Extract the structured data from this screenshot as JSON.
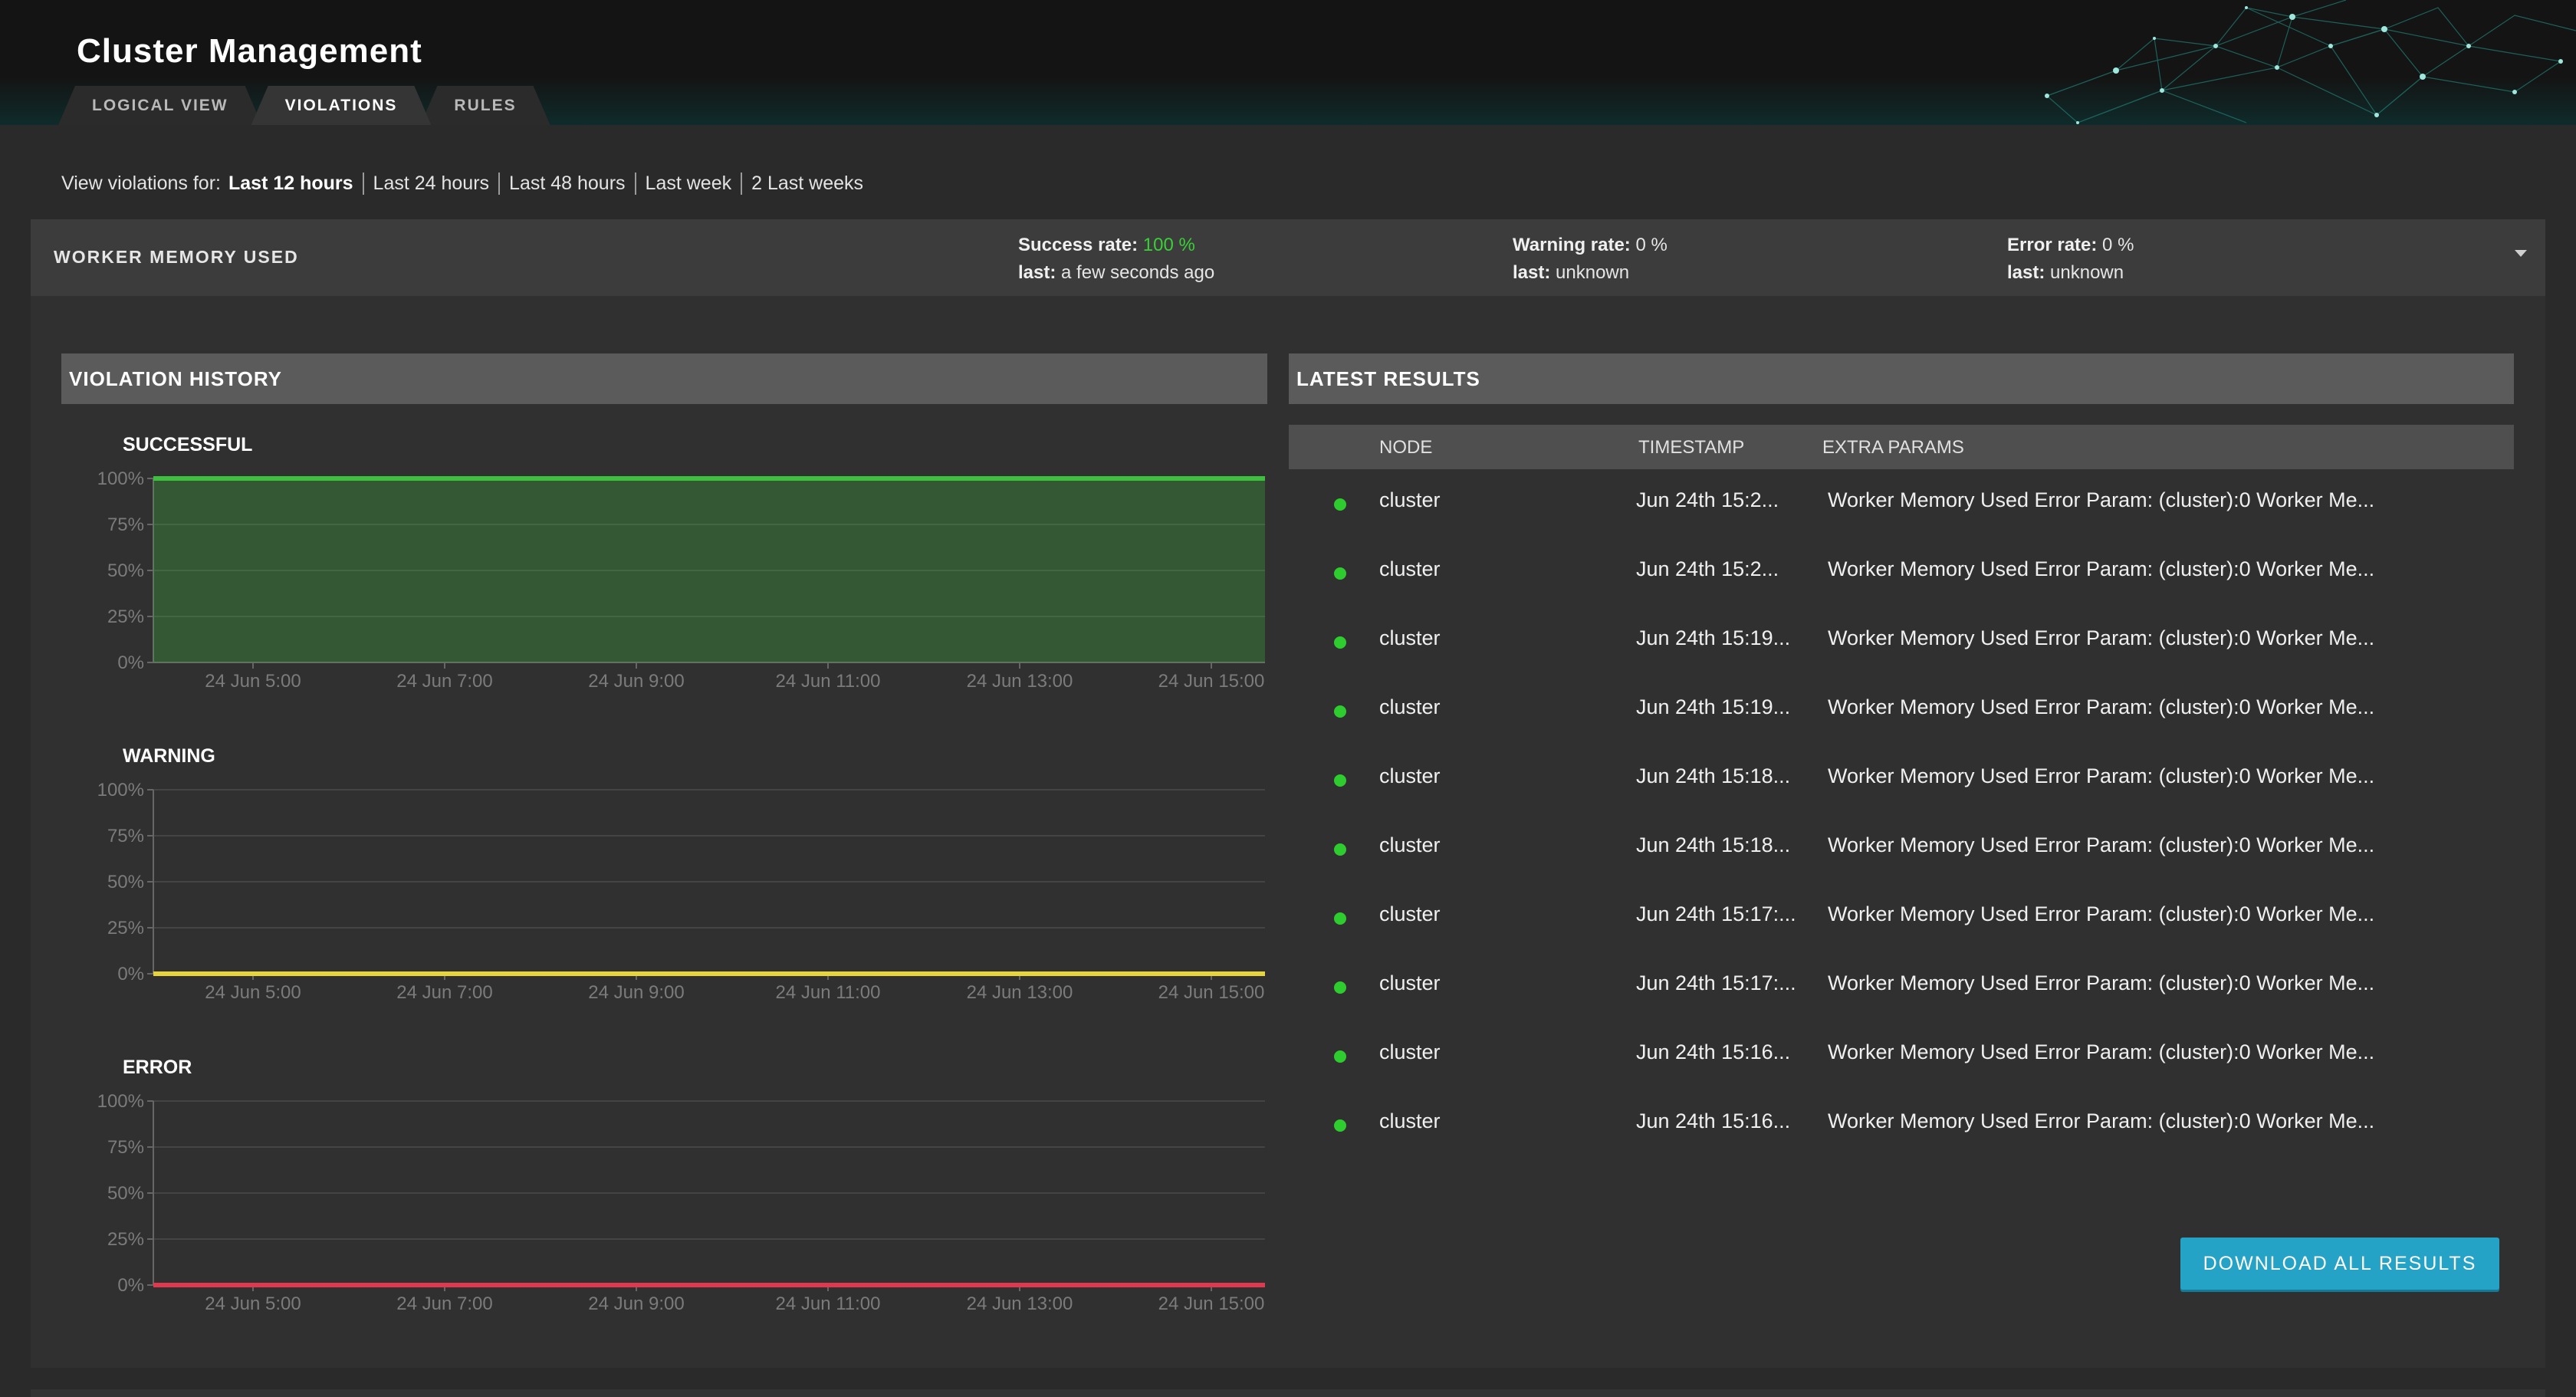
{
  "header": {
    "title": "Cluster Management",
    "tabs": [
      {
        "label": "LOGICAL VIEW",
        "active": false
      },
      {
        "label": "VIOLATIONS",
        "active": true
      },
      {
        "label": "RULES",
        "active": false
      }
    ]
  },
  "range": {
    "label": "View violations for:",
    "options": [
      {
        "label": "Last 12 hours",
        "active": true
      },
      {
        "label": "Last 24 hours",
        "active": false
      },
      {
        "label": "Last 48 hours",
        "active": false
      },
      {
        "label": "Last week",
        "active": false
      },
      {
        "label": "2 Last weeks",
        "active": false
      }
    ]
  },
  "rule": {
    "name": "WORKER MEMORY USED",
    "success": {
      "label": "Success rate:",
      "value": "100 %",
      "last_label": "last:",
      "last": "a few seconds ago"
    },
    "warning": {
      "label": "Warning rate:",
      "value": "0 %",
      "last_label": "last:",
      "last": "unknown"
    },
    "error": {
      "label": "Error rate:",
      "value": "0 %",
      "last_label": "last:",
      "last": "unknown"
    },
    "expand_icon": "chevron-down-icon"
  },
  "history": {
    "title": "VIOLATION HISTORY",
    "charts": [
      "SUCCESSFUL",
      "WARNING",
      "ERROR"
    ]
  },
  "chart_data": [
    {
      "type": "area",
      "title": "SUCCESSFUL",
      "x": [
        "24 Jun 5:00",
        "24 Jun 7:00",
        "24 Jun 9:00",
        "24 Jun 11:00",
        "24 Jun 13:00",
        "24 Jun 15:00"
      ],
      "y_ticks": [
        "100%",
        "75%",
        "50%",
        "25%",
        "0%"
      ],
      "ylim": [
        0,
        100
      ],
      "series": [
        {
          "values": [
            100,
            100,
            100,
            100,
            100,
            100
          ],
          "color": "#3fbf3f"
        }
      ],
      "grid": true
    },
    {
      "type": "line",
      "title": "WARNING",
      "x": [
        "24 Jun 5:00",
        "24 Jun 7:00",
        "24 Jun 9:00",
        "24 Jun 11:00",
        "24 Jun 13:00",
        "24 Jun 15:00"
      ],
      "y_ticks": [
        "100%",
        "75%",
        "50%",
        "25%",
        "0%"
      ],
      "ylim": [
        0,
        100
      ],
      "series": [
        {
          "values": [
            0,
            0,
            0,
            0,
            0,
            0
          ],
          "color": "#e5d43a"
        }
      ],
      "grid": true
    },
    {
      "type": "line",
      "title": "ERROR",
      "x": [
        "24 Jun 5:00",
        "24 Jun 7:00",
        "24 Jun 9:00",
        "24 Jun 11:00",
        "24 Jun 13:00",
        "24 Jun 15:00"
      ],
      "y_ticks": [
        "100%",
        "75%",
        "50%",
        "25%",
        "0%"
      ],
      "ylim": [
        0,
        100
      ],
      "series": [
        {
          "values": [
            0,
            0,
            0,
            0,
            0,
            0
          ],
          "color": "#e0394f"
        }
      ],
      "grid": true
    }
  ],
  "results": {
    "title": "LATEST RESULTS",
    "columns": {
      "node": "NODE",
      "timestamp": "TIMESTAMP",
      "params": "EXTRA PARAMS"
    },
    "rows": [
      {
        "node": "cluster",
        "timestamp": "Jun 24th 15:2...",
        "params": "Worker Memory Used Error Param: (cluster):0 Worker Me..."
      },
      {
        "node": "cluster",
        "timestamp": "Jun 24th 15:2...",
        "params": "Worker Memory Used Error Param: (cluster):0 Worker Me..."
      },
      {
        "node": "cluster",
        "timestamp": "Jun 24th 15:19...",
        "params": "Worker Memory Used Error Param: (cluster):0 Worker Me..."
      },
      {
        "node": "cluster",
        "timestamp": "Jun 24th 15:19...",
        "params": "Worker Memory Used Error Param: (cluster):0 Worker Me..."
      },
      {
        "node": "cluster",
        "timestamp": "Jun 24th 15:18...",
        "params": "Worker Memory Used Error Param: (cluster):0 Worker Me..."
      },
      {
        "node": "cluster",
        "timestamp": "Jun 24th 15:18...",
        "params": "Worker Memory Used Error Param: (cluster):0 Worker Me..."
      },
      {
        "node": "cluster",
        "timestamp": "Jun 24th 15:17:...",
        "params": "Worker Memory Used Error Param: (cluster):0 Worker Me..."
      },
      {
        "node": "cluster",
        "timestamp": "Jun 24th 15:17:...",
        "params": "Worker Memory Used Error Param: (cluster):0 Worker Me..."
      },
      {
        "node": "cluster",
        "timestamp": "Jun 24th 15:16...",
        "params": "Worker Memory Used Error Param: (cluster):0 Worker Me..."
      },
      {
        "node": "cluster",
        "timestamp": "Jun 24th 15:16...",
        "params": "Worker Memory Used Error Param: (cluster):0 Worker Me..."
      }
    ],
    "status_color": "#2ecc2e",
    "download_label": "DOWNLOAD ALL RESULTS"
  }
}
